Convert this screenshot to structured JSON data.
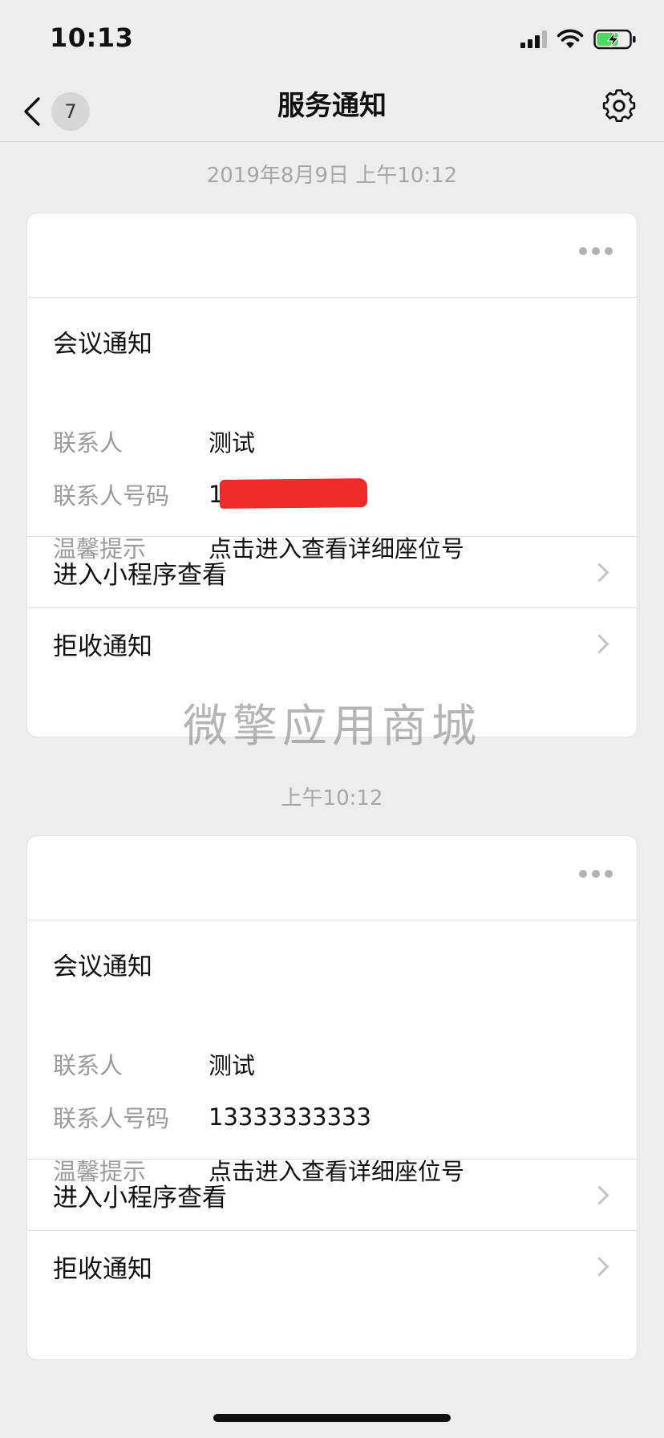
{
  "status_bar": {
    "time": "10:13",
    "icons": [
      "signal-icon",
      "wifi-icon",
      "battery-charging-icon"
    ],
    "battery_color": "#4cd964"
  },
  "nav": {
    "back_icon": "chevron-left-icon",
    "unread_count": "7",
    "title": "服务通知",
    "settings_icon": "gear-icon"
  },
  "messages": [
    {
      "timestamp": "2019年8月9日 上午10:12",
      "title": "会议通知",
      "fields": [
        {
          "label": "联系人",
          "value": "测试"
        },
        {
          "label": "联系人号码",
          "value": "1"
        },
        {
          "label": "温馨提示",
          "value": "点击进入查看详细座位号"
        }
      ],
      "actions": [
        {
          "label": "进入小程序查看"
        },
        {
          "label": "拒收通知"
        }
      ]
    },
    {
      "timestamp": "上午10:12",
      "title": "会议通知",
      "fields": [
        {
          "label": "联系人",
          "value": "测试"
        },
        {
          "label": "联系人号码",
          "value": "13333333333"
        },
        {
          "label": "温馨提示",
          "value": "点击进入查看详细座位号"
        }
      ],
      "actions": [
        {
          "label": "进入小程序查看"
        },
        {
          "label": "拒收通知"
        }
      ]
    }
  ],
  "watermark": "微擎应用商城",
  "colors": {
    "background": "#ededed",
    "redaction": "#ee2b2b"
  }
}
